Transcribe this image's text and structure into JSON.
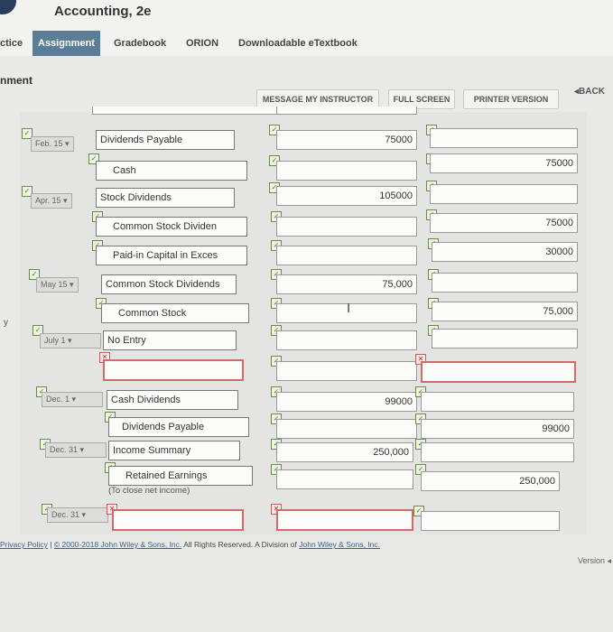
{
  "header": {
    "title": "Accounting, 2e"
  },
  "nav": {
    "tabs": [
      "ctice",
      "Assignment",
      "Gradebook",
      "ORION",
      "Downloadable eTextbook"
    ]
  },
  "section": {
    "label": "nment"
  },
  "toolbar": {
    "message": "MESSAGE MY INSTRUCTOR",
    "fullscreen": "FULL SCREEN",
    "printer": "PRINTER VERSION",
    "back": "BACK"
  },
  "side_mark": "y",
  "entries": [
    {
      "date": "Feb. 15",
      "account": "Dividends Payable",
      "debit": "75000",
      "credit": ""
    },
    {
      "date": "",
      "account": "Cash",
      "debit": "",
      "credit": "75000"
    },
    {
      "date": "Apr. 15",
      "account": "Stock Dividends",
      "debit": "105000",
      "credit": ""
    },
    {
      "date": "",
      "account": "Common Stock Dividen",
      "debit": "",
      "credit": "75000"
    },
    {
      "date": "",
      "account": "Paid-in Capital in Exces",
      "debit": "",
      "credit": "30000"
    },
    {
      "date": "May 15",
      "account": "Common Stock Dividends",
      "debit": "75,000",
      "credit": ""
    },
    {
      "date": "",
      "account": "Common Stock",
      "debit": "",
      "credit": "75,000"
    },
    {
      "date": "July 1",
      "account": "No Entry",
      "debit": "",
      "credit": ""
    },
    {
      "date": "",
      "account": "",
      "debit": "",
      "credit": ""
    },
    {
      "date": "Dec. 1",
      "account": "Cash Dividends",
      "debit": "99000",
      "credit": ""
    },
    {
      "date": "",
      "account": "Dividends Payable",
      "debit": "",
      "credit": "99000"
    },
    {
      "date": "Dec. 31",
      "account": "Income Summary",
      "debit": "250,000",
      "credit": ""
    },
    {
      "date": "",
      "account": "Retained Earnings",
      "debit": "",
      "credit": "250,000"
    },
    {
      "date": "Dec. 31",
      "account": "",
      "debit": "",
      "credit": ""
    }
  ],
  "closing_note": "(To close net income)",
  "footer": {
    "privacy": "Privacy Policy",
    "sep": "|",
    "copyright": "© 2000-2018 John Wiley & Sons, Inc.",
    "rights": "All Rights Reserved. A Division of",
    "company": "John Wiley & Sons, Inc.",
    "version": "Version"
  }
}
